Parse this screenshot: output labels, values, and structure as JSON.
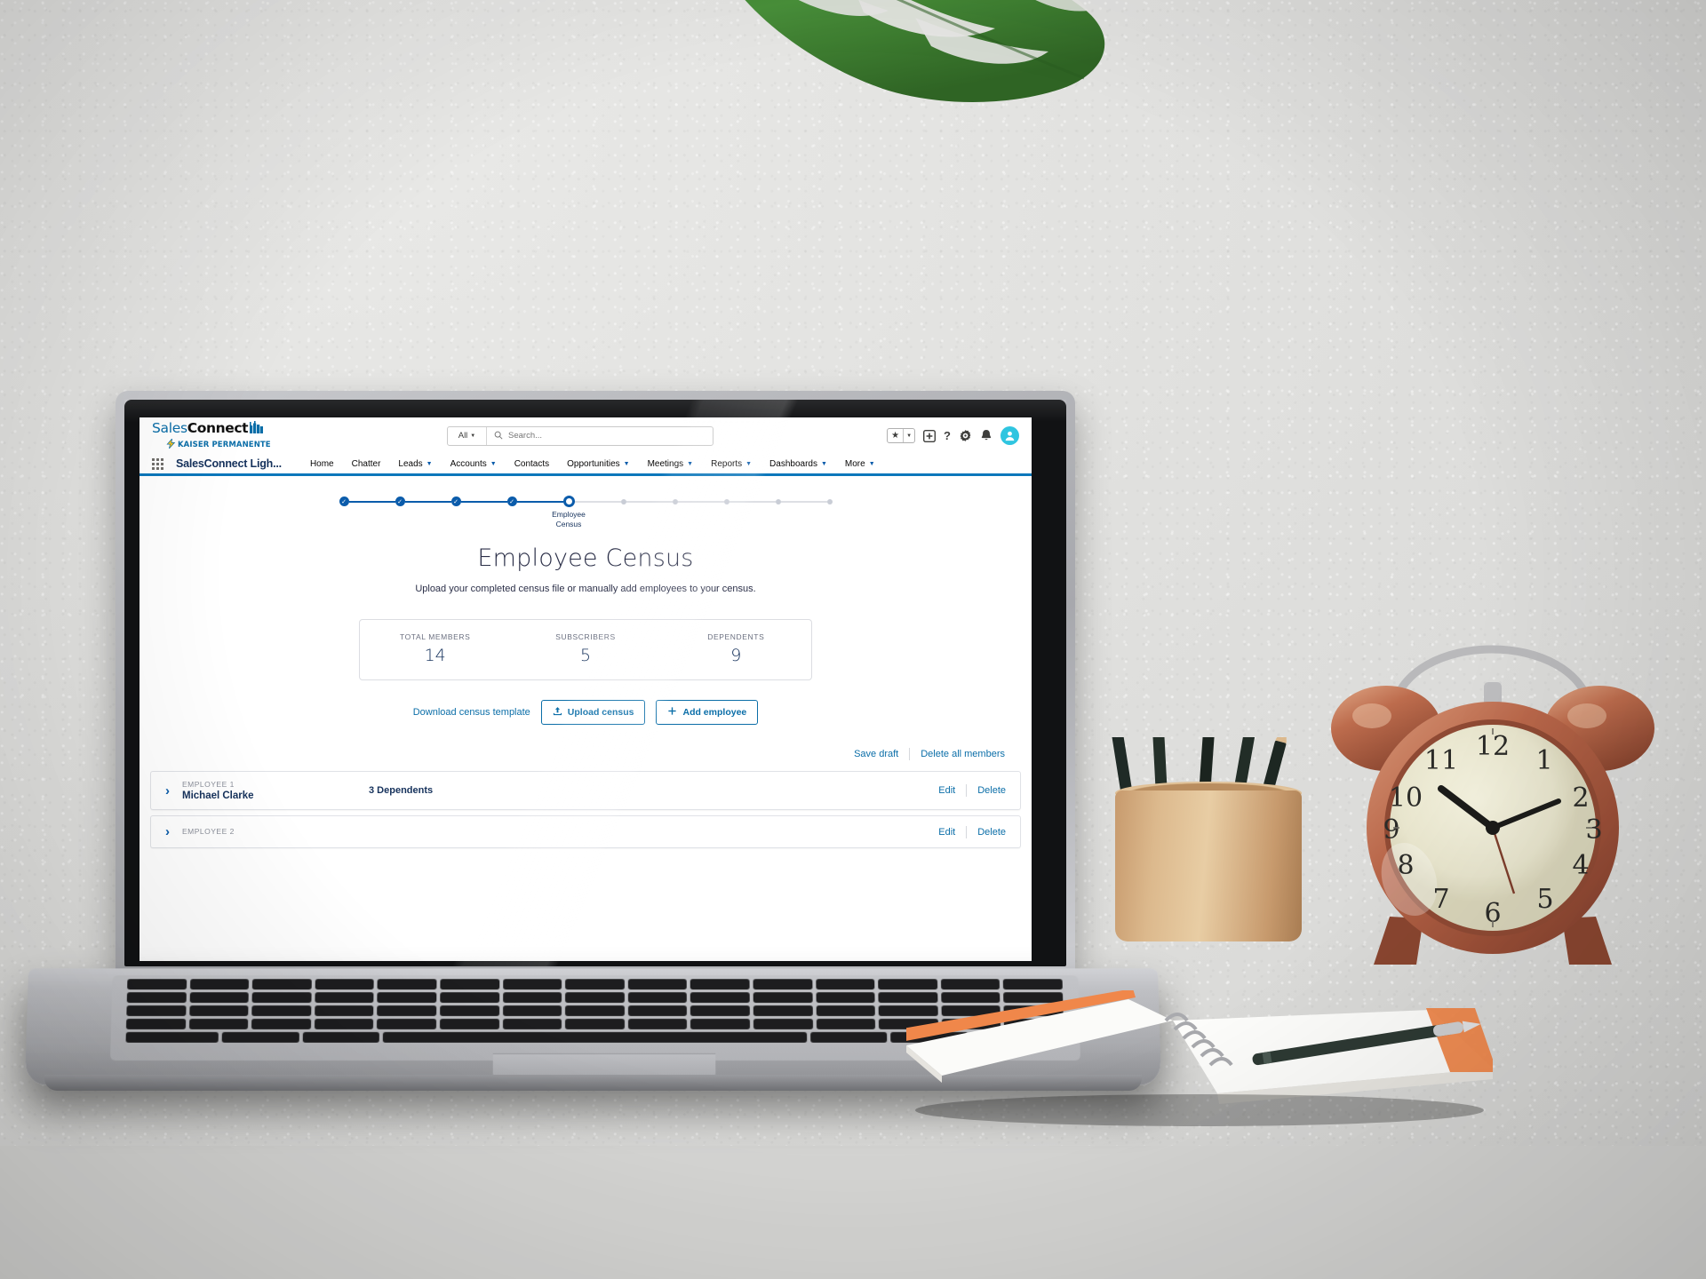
{
  "scene": {
    "description": "Photo of a laptop on a dark desk showing a Salesforce Lightning page",
    "objects": [
      "monstera-leaf",
      "laptop",
      "pencil-cup",
      "alarm-clock",
      "notebook",
      "pen"
    ]
  },
  "browser": {
    "header": {
      "logo": {
        "sales": "Sales",
        "connect": "Connect",
        "subtitle": "KAISER PERMANENTE"
      },
      "search": {
        "scope_label": "All",
        "placeholder": "Search...",
        "value": ""
      },
      "icons": [
        {
          "name": "favorites-star-icon",
          "glyph": "★"
        },
        {
          "name": "favorites-dropdown-icon",
          "glyph": "▾"
        },
        {
          "name": "add-item-icon",
          "glyph": "+"
        },
        {
          "name": "help-icon",
          "glyph": "?"
        },
        {
          "name": "setup-gear-icon",
          "glyph": "⚙"
        },
        {
          "name": "notifications-bell-icon",
          "glyph": "ὑ4"
        },
        {
          "name": "user-avatar",
          "glyph": "὆4"
        }
      ]
    },
    "nav": {
      "app_name": "SalesConnect Ligh...",
      "items": [
        {
          "label": "Home",
          "has_caret": false
        },
        {
          "label": "Chatter",
          "has_caret": false
        },
        {
          "label": "Leads",
          "has_caret": true
        },
        {
          "label": "Accounts",
          "has_caret": true
        },
        {
          "label": "Contacts",
          "has_caret": false
        },
        {
          "label": "Opportunities",
          "has_caret": true
        },
        {
          "label": "Meetings",
          "has_caret": true
        },
        {
          "label": "Reports",
          "has_caret": true
        },
        {
          "label": "Dashboards",
          "has_caret": true
        },
        {
          "label": "More",
          "has_caret": true
        }
      ],
      "accent_color": "#0c77bb"
    },
    "page": {
      "stepper": {
        "completed_steps": 4,
        "current_step_index": 5,
        "remaining_steps": 5,
        "current_label_line1": "Employee",
        "current_label_line2": "Census",
        "done_color": "#0b5cab",
        "todo_color": "#c9cdd6"
      },
      "title": "Employee Census",
      "subtitle": "Upload your completed census file or manually add employees to your census.",
      "stats": [
        {
          "label": "TOTAL MEMBERS",
          "value": "14"
        },
        {
          "label": "SUBSCRIBERS",
          "value": "5"
        },
        {
          "label": "DEPENDENTS",
          "value": "9"
        }
      ],
      "actions": {
        "download_template": "Download census template",
        "upload_census": "Upload census",
        "add_employee": "Add employee"
      },
      "subactions": {
        "save_draft": "Save draft",
        "delete_all": "Delete all members"
      },
      "employees": [
        {
          "index_label": "EMPLOYEE 1",
          "name": "Michael Clarke",
          "dependents": "3 Dependents",
          "edit": "Edit",
          "delete": "Delete"
        },
        {
          "index_label": "EMPLOYEE 2",
          "name": "",
          "dependents": "",
          "edit": "Edit",
          "delete": "Delete"
        }
      ]
    }
  }
}
